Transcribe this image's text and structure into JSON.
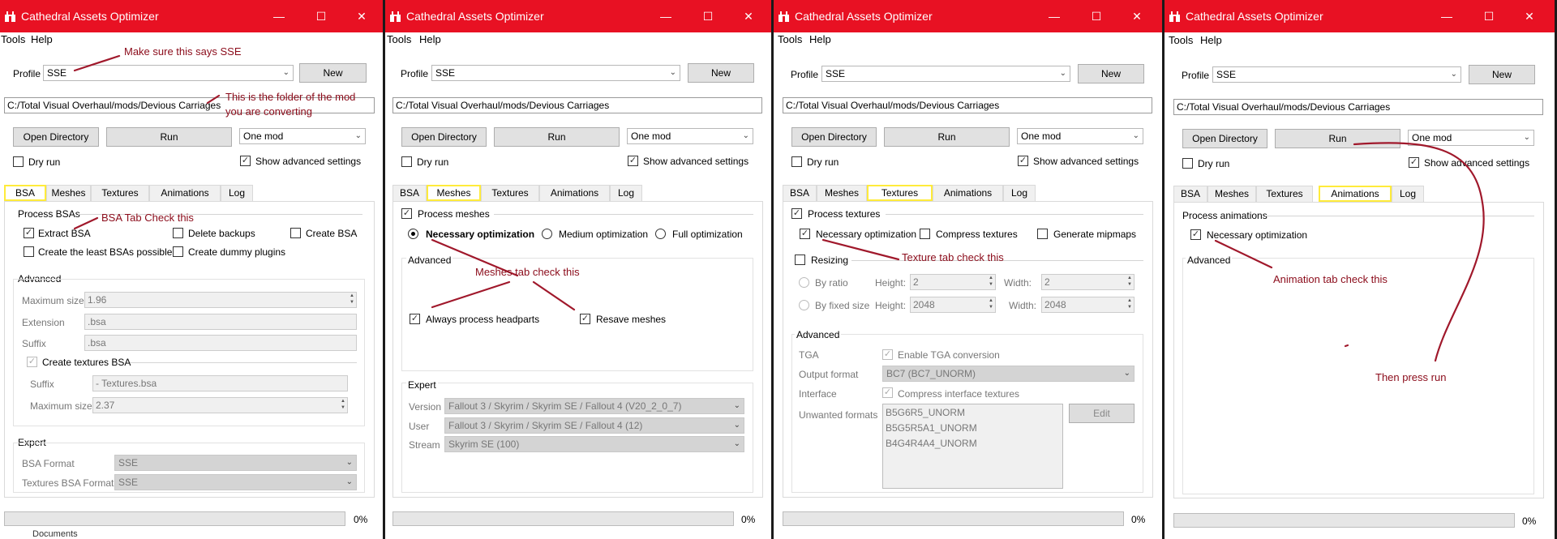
{
  "app": {
    "title": "Cathedral Assets Optimizer"
  },
  "menu": {
    "tools": "Tools",
    "help": "Help"
  },
  "common": {
    "profile_label": "Profile",
    "profile_value": "SSE",
    "new_label": "New",
    "path_value": "C:/Total Visual Overhaul/mods/Devious Carriages",
    "open_dir_label": "Open Directory",
    "run_label": "Run",
    "mode_value": "One mod",
    "dry_run_label": "Dry run",
    "show_adv_label": "Show advanced settings",
    "progress_text": "0%",
    "progress_value": 0
  },
  "tabs": [
    "BSA",
    "Meshes",
    "Textures",
    "Animations",
    "Log"
  ],
  "bsa": {
    "process_label": "Process BSAs",
    "extract": "Extract BSA",
    "delete_backups": "Delete backups",
    "create_bsa": "Create BSA",
    "least_bsas": "Create the least BSAs possible",
    "dummy_plugins": "Create dummy plugins",
    "advanced": "Advanced",
    "max_size_label": "Maximum size",
    "max_size_value": "1.96",
    "extension_label": "Extension",
    "extension_value": ".bsa",
    "suffix_label": "Suffix",
    "suffix_value": ".bsa",
    "create_tex_bsa": "Create textures BSA",
    "tex_suffix_label": "Suffix",
    "tex_suffix_value": "- Textures.bsa",
    "tex_max_label": "Maximum size",
    "tex_max_value": "2.37",
    "expert": "Expert",
    "format_label": "BSA Format",
    "format_value": "SSE",
    "tex_format_label": "Textures BSA Format",
    "tex_format_value": "SSE"
  },
  "meshes": {
    "process_label": "Process meshes",
    "necessary": "Necessary optimization",
    "medium": "Medium optimization",
    "full": "Full optimization",
    "advanced": "Advanced",
    "headparts": "Always process headparts",
    "resave": "Resave meshes",
    "expert": "Expert",
    "version_label": "Version",
    "version_value": "Fallout 3 / Skyrim / Skyrim SE / Fallout 4 (V20_2_0_7)",
    "user_label": "User",
    "user_value": "Fallout 3 / Skyrim / Skyrim SE / Fallout 4 (12)",
    "stream_label": "Stream",
    "stream_value": "Skyrim SE (100)"
  },
  "textures": {
    "process_label": "Process textures",
    "necessary": "Necessary optimization",
    "compress": "Compress textures",
    "mipmaps": "Generate mipmaps",
    "resizing": "Resizing",
    "by_ratio": "By ratio",
    "by_fixed": "By fixed size",
    "height_label": "Height:",
    "width_label": "Width:",
    "ratio_h": "2",
    "ratio_w": "2",
    "fixed_h": "2048",
    "fixed_w": "2048",
    "advanced": "Advanced",
    "tga_label": "TGA",
    "tga_conv": "Enable TGA conversion",
    "output_label": "Output format",
    "output_value": "BC7 (BC7_UNORM)",
    "interface_label": "Interface",
    "interface_check": "Compress interface textures",
    "unwanted_label": "Unwanted formats",
    "unwanted": [
      "B5G6R5_UNORM",
      "B5G5R5A1_UNORM",
      "B4G4R4A4_UNORM"
    ],
    "edit_label": "Edit"
  },
  "animations": {
    "process_label": "Process animations",
    "necessary": "Necessary optimization",
    "advanced": "Advanced"
  },
  "annotations": {
    "sse": "Make sure this says SSE",
    "folder1": "This is the folder of the mod",
    "folder2": "you are converting",
    "bsa": "BSA Tab Check this",
    "meshes": "Meshes tab check this",
    "textures": "Texture tab check this",
    "animations": "Animation tab check this",
    "run": "Then press run"
  },
  "taskbar": {
    "item": "Documents"
  },
  "colors": {
    "titlebar": "#e81123",
    "annotation": "#8b0b1a",
    "highlight": "#ffeb3b"
  }
}
